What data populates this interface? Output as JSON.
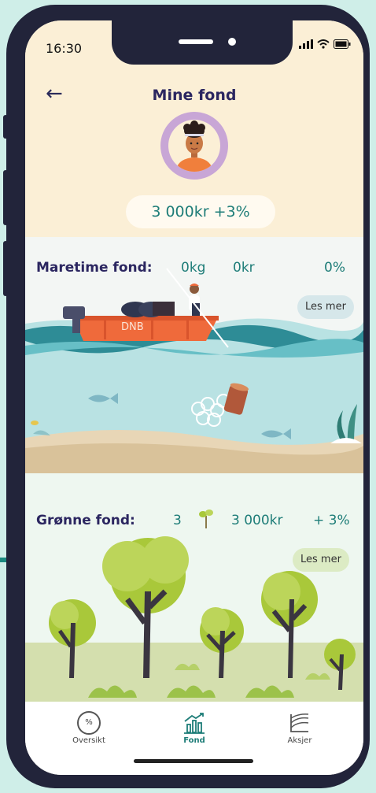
{
  "status": {
    "time": "16:30"
  },
  "header": {
    "back_glyph": "←",
    "title": "Mine fond",
    "balance": "3 000kr  +3%"
  },
  "marine": {
    "title": "Maretime fond:",
    "kg": "0kg",
    "kr": "0kr",
    "pct": "0%",
    "read_more": "Les mer",
    "boat_label": "DNB"
  },
  "green": {
    "title": "Grønne fond:",
    "count": "3",
    "kr": "3 000kr",
    "pct": "+ 3%",
    "read_more": "Les mer"
  },
  "tabs": [
    {
      "label": "Oversikt",
      "icon": "percent-icon",
      "icon_text": "%"
    },
    {
      "label": "Fond",
      "icon": "chart-icon"
    },
    {
      "label": "Aksjer",
      "icon": "stocks-icon"
    }
  ],
  "colors": {
    "accent": "#1e7d78",
    "title": "#2b2660",
    "header_bg": "#fbefd6",
    "avatar_ring": "#c8a6d6"
  }
}
